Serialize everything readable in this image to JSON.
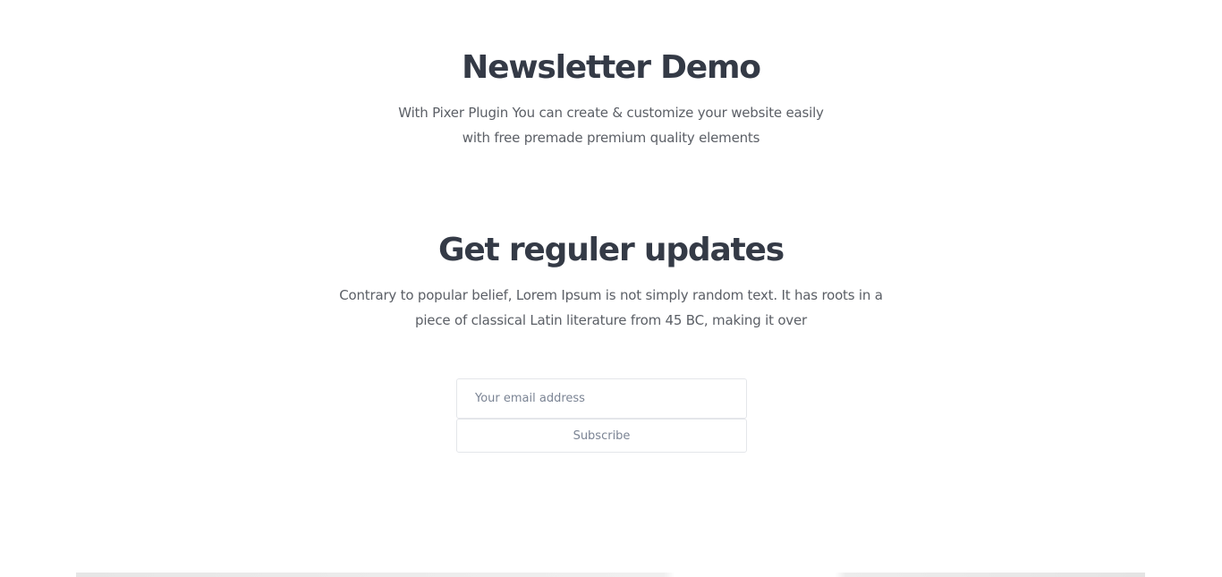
{
  "newsletter_demo": {
    "title": "Newsletter Demo",
    "subtitle_line1": "With Pixer Plugin You can create & customize your website easily",
    "subtitle_line2": "with free premade premium quality elements"
  },
  "updates": {
    "title": "Get reguler updates",
    "text_line1": "Contrary to popular belief, Lorem Ipsum is not simply random text. It has roots in a",
    "text_line2": "piece of classical Latin literature from 45 BC, making it over"
  },
  "form": {
    "email_placeholder": "Your email address",
    "subscribe_label": "Subscribe"
  },
  "colors": {
    "heading": "#343a46",
    "body_text": "#5b5f66",
    "input_border": "#e4e6ea",
    "placeholder": "#7b8494"
  }
}
